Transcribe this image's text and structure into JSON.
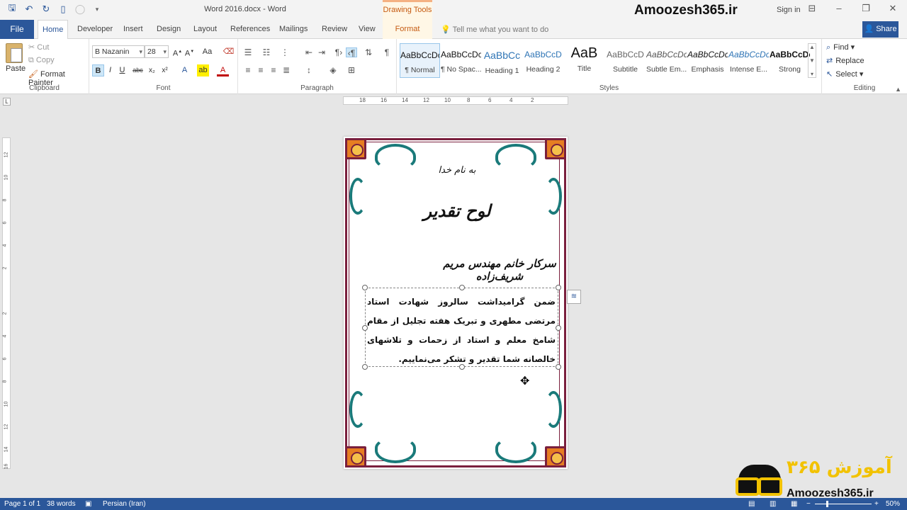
{
  "window": {
    "doc_title": "Word 2016.docx - Word",
    "contextual_tab_group": "Drawing Tools",
    "brand": "Amoozesh365.ir",
    "sign_in": "Sign in",
    "share": "Share"
  },
  "tabs": {
    "file": "File",
    "items": [
      "Home",
      "Developer",
      "Insert",
      "Design",
      "Layout",
      "References",
      "Mailings",
      "Review",
      "View",
      "Format"
    ],
    "tell_me": "Tell me what you want to do"
  },
  "clipboard": {
    "paste": "Paste",
    "cut": "Cut",
    "copy": "Copy",
    "format_painter": "Format Painter",
    "label": "Clipboard"
  },
  "font": {
    "name": "B Nazanin",
    "size": "28",
    "label": "Font"
  },
  "paragraph": {
    "label": "Paragraph"
  },
  "styles": {
    "label": "Styles",
    "items": [
      {
        "sample": "AaBbCcDc",
        "name": "¶ Normal"
      },
      {
        "sample": "AaBbCcDc",
        "name": "¶ No Spac..."
      },
      {
        "sample": "AaBbCc",
        "name": "Heading 1"
      },
      {
        "sample": "AaBbCcD",
        "name": "Heading 2"
      },
      {
        "sample": "AaB",
        "name": "Title"
      },
      {
        "sample": "AaBbCcD",
        "name": "Subtitle"
      },
      {
        "sample": "AaBbCcDc",
        "name": "Subtle Em..."
      },
      {
        "sample": "AaBbCcDc",
        "name": "Emphasis"
      },
      {
        "sample": "AaBbCcDc",
        "name": "Intense E..."
      },
      {
        "sample": "AaBbCcDc",
        "name": "Strong"
      }
    ]
  },
  "editing": {
    "find": "Find",
    "replace": "Replace",
    "select": "Select",
    "label": "Editing"
  },
  "ruler": {
    "h_ticks": [
      "18",
      "16",
      "14",
      "12",
      "10",
      "8",
      "6",
      "4",
      "2"
    ],
    "v_ticks": [
      "12",
      "10",
      "8",
      "6",
      "4",
      "2",
      "2",
      "4",
      "6",
      "8",
      "10",
      "12",
      "14",
      "16"
    ]
  },
  "document": {
    "bismillah": "به نام خدا",
    "title": "لوح تقدیر",
    "recipient": "سرکار خانم مهندس مریم شریف‌زاده",
    "body": "ضمن گرامیداشت سالروز شهادت استاد مرتضی مطهری و تبریک هفته تجلیل از مقام شامخ معلم و استاد از زحمات و تلاشهای خالصانه شما تقدیر و تشکر می‌نماییم."
  },
  "watermark": {
    "fa_text": "آموزش ۳۶۵",
    "url": "Amoozesh365.ir"
  },
  "status": {
    "page": "Page 1 of 1",
    "words": "38 words",
    "language": "Persian (Iran)",
    "zoom": "50%"
  }
}
